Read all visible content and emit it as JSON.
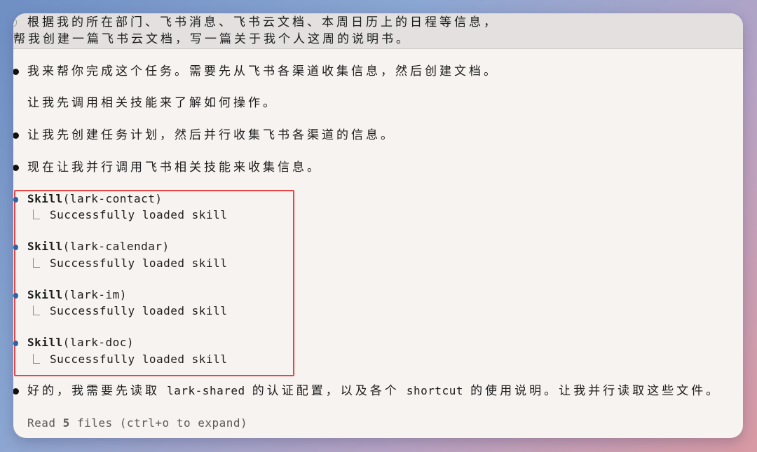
{
  "prompt": {
    "line1": "根据我的所在部门、飞书消息、飞书云文档、本周日历上的日程等信息，",
    "line2": "帮我创建一篇飞书云文档，写一篇关于我个人这周的说明书。"
  },
  "messages": [
    {
      "text": "我来帮你完成这个任务。需要先从飞书各渠道收集信息，然后创建文档。"
    },
    {
      "text": "让我先调用相关技能来了解如何操作。"
    },
    {
      "text": "让我先创建任务计划，然后并行收集飞书各渠道的信息。"
    },
    {
      "text": "现在让我并行调用飞书相关技能来收集信息。"
    }
  ],
  "tool_calls": [
    {
      "name": "Skill",
      "arg": "(lark-contact)",
      "result": "Successfully loaded skill"
    },
    {
      "name": "Skill",
      "arg": "(lark-calendar)",
      "result": "Successfully loaded skill"
    },
    {
      "name": "Skill",
      "arg": "(lark-im)",
      "result": "Successfully loaded skill"
    },
    {
      "name": "Skill",
      "arg": "(lark-doc)",
      "result": "Successfully loaded skill"
    }
  ],
  "final_message": {
    "part1": "好的，我需要先读取",
    "code1": "lark-shared",
    "part2": "的认证配置，以及各个",
    "code2": "shortcut",
    "part3": "的使用说明。让我并行读取这些文件。"
  },
  "read_status": {
    "prefix": "Read ",
    "count": "5",
    "suffix": " files (ctrl+o to expand)"
  },
  "colors": {
    "highlight": "#e64545",
    "tool_bullet": "#2b63a8",
    "background": "#f7f3f0"
  }
}
